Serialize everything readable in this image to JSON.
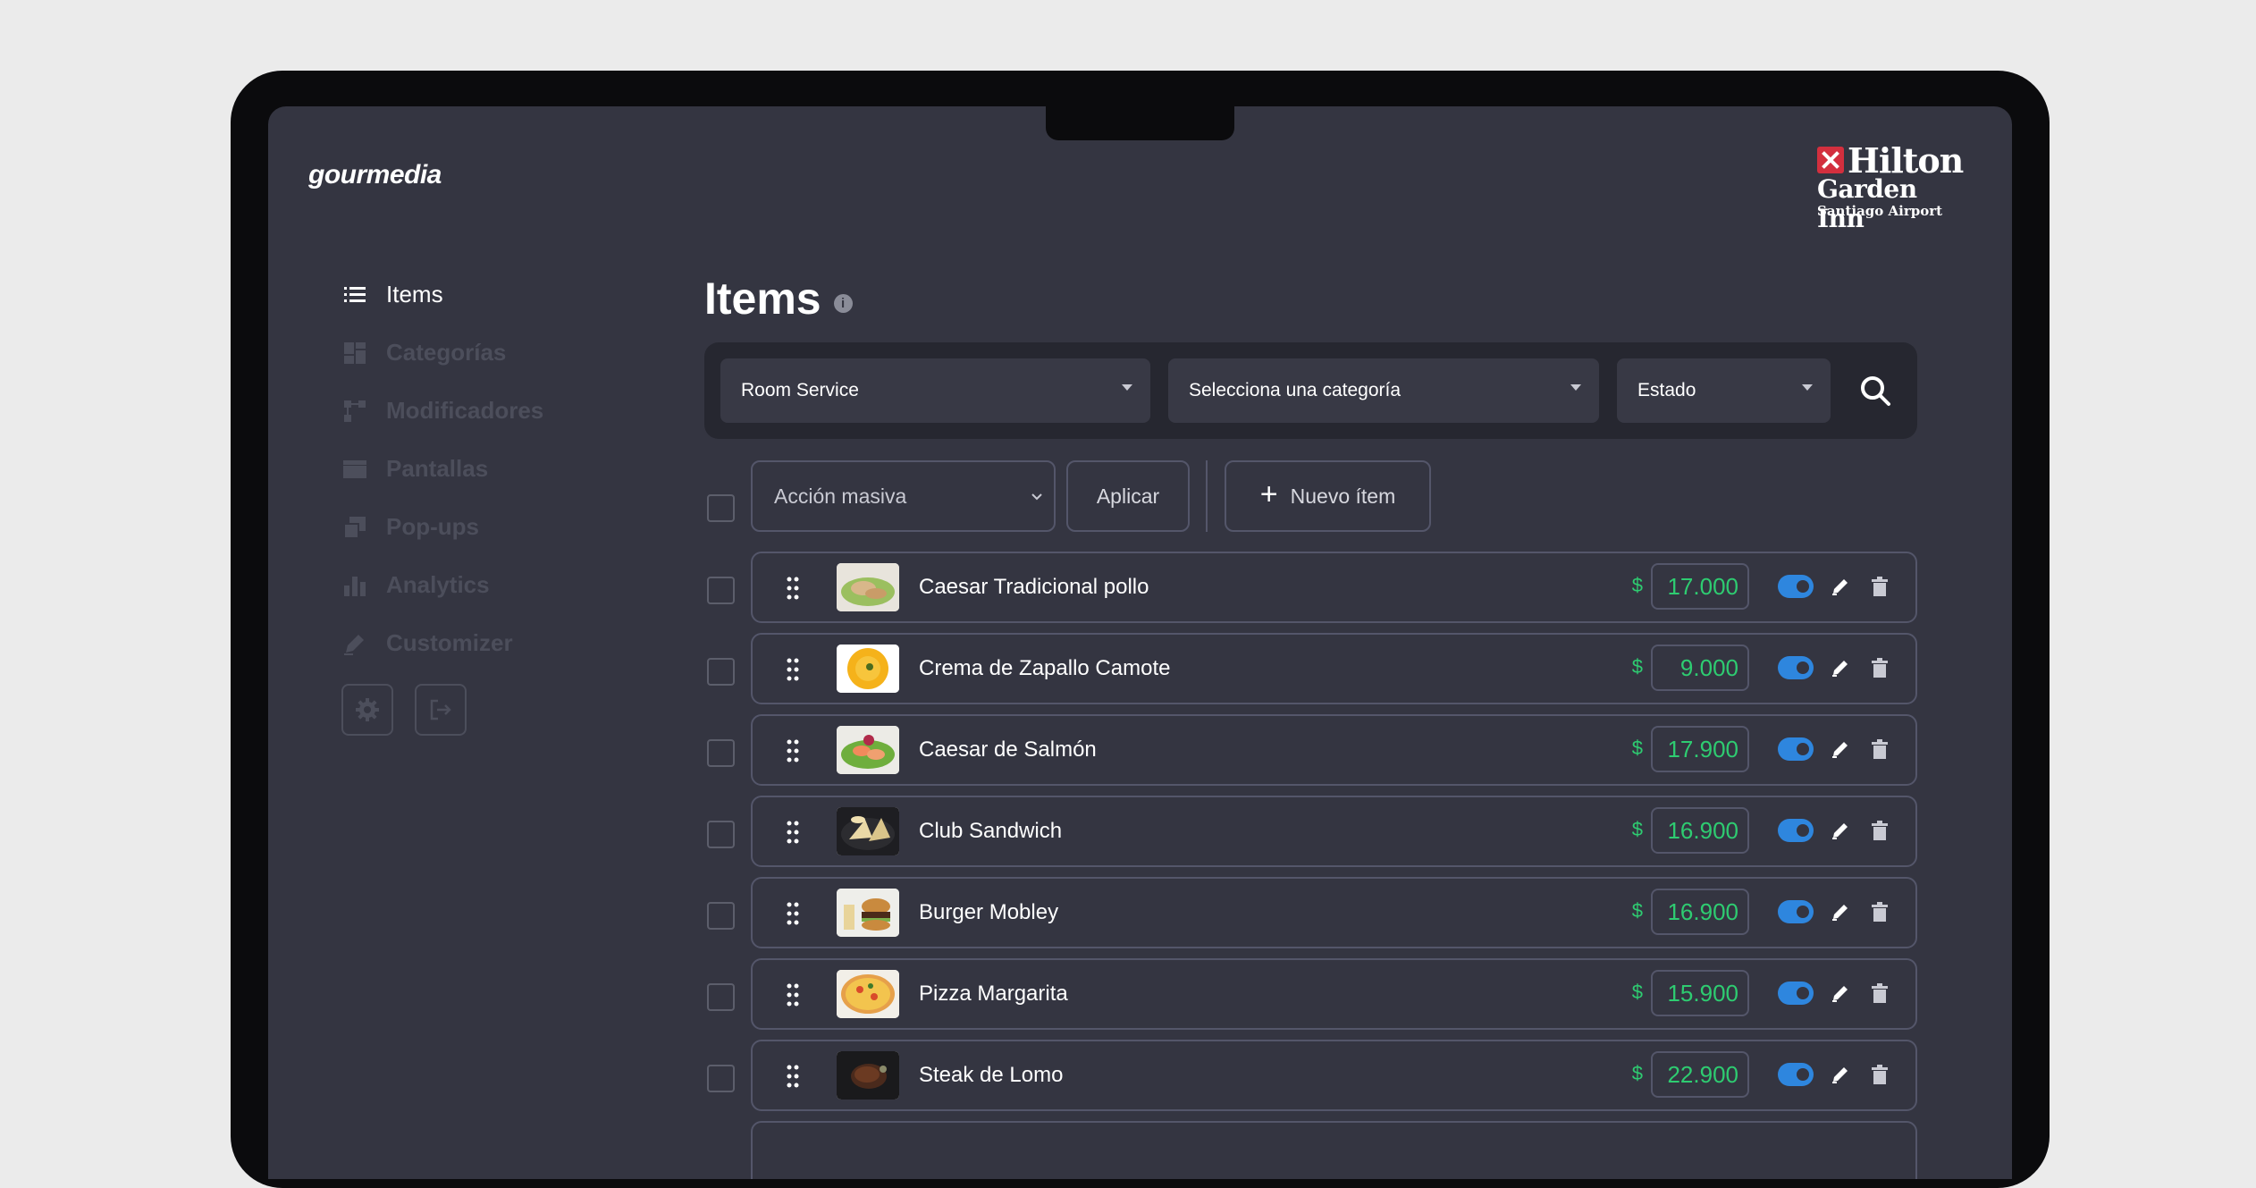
{
  "brand": "gourmedia",
  "hotel_logo": {
    "line1": "Hilton",
    "line2": "Garden Inn",
    "line3": "Santiago Airport"
  },
  "sidebar": {
    "items": [
      {
        "label": "Items",
        "icon": "list-icon",
        "active": true
      },
      {
        "label": "Categorías",
        "icon": "grid-icon",
        "active": false
      },
      {
        "label": "Modificadores",
        "icon": "hierarchy-icon",
        "active": false
      },
      {
        "label": "Pantallas",
        "icon": "window-icon",
        "active": false
      },
      {
        "label": "Pop-ups",
        "icon": "popup-icon",
        "active": false
      },
      {
        "label": "Analytics",
        "icon": "bar-chart-icon",
        "active": false
      },
      {
        "label": "Customizer",
        "icon": "pencil-icon",
        "active": false
      }
    ],
    "actions": [
      "gear-icon",
      "logout-icon"
    ]
  },
  "main": {
    "title": "Items",
    "filters": {
      "service": "Room Service",
      "category": "Selecciona una categoría",
      "status": "Estado"
    },
    "bulk": {
      "action_placeholder": "Acción masiva",
      "apply_label": "Aplicar",
      "new_item_label": "Nuevo ítem"
    },
    "items": [
      {
        "name": "Caesar Tradicional pollo",
        "currency": "$",
        "price": "17.000",
        "enabled": true
      },
      {
        "name": "Crema de Zapallo Camote",
        "currency": "$",
        "price": "9.000",
        "enabled": true
      },
      {
        "name": "Caesar de Salmón",
        "currency": "$",
        "price": "17.900",
        "enabled": true
      },
      {
        "name": "Club Sandwich",
        "currency": "$",
        "price": "16.900",
        "enabled": true
      },
      {
        "name": "Burger Mobley",
        "currency": "$",
        "price": "16.900",
        "enabled": true
      },
      {
        "name": "Pizza Margarita",
        "currency": "$",
        "price": "15.900",
        "enabled": true
      },
      {
        "name": "Steak de Lomo",
        "currency": "$",
        "price": "22.900",
        "enabled": true
      }
    ]
  },
  "colors": {
    "background": "#343541",
    "accent_green": "#2ecc71",
    "toggle_blue": "#2e86de",
    "hotel_red": "#d32f3e"
  }
}
